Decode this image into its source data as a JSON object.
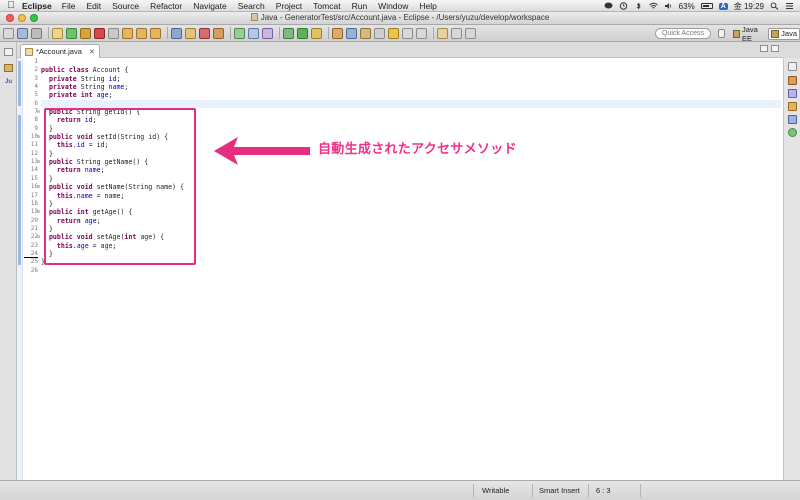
{
  "menubar": {
    "app_name": "Eclipse",
    "items": [
      "File",
      "Edit",
      "Source",
      "Refactor",
      "Navigate",
      "Search",
      "Project",
      "Tomcat",
      "Run",
      "Window",
      "Help"
    ],
    "battery": "63%",
    "input_badge": "A",
    "clock": "金 19:29"
  },
  "window": {
    "title": "Java - GeneratorTest/src/Account.java - Eclipse - /Users/yuzu/develop/workspace"
  },
  "toolbar": {
    "quick_access": "Quick Access",
    "perspectives": [
      {
        "label": "Java EE",
        "active": false
      },
      {
        "label": "Java",
        "active": true
      }
    ]
  },
  "editor_tab": {
    "label": "*Account.java",
    "close": "✕"
  },
  "code_lines": [
    {
      "n": "1",
      "t": ""
    },
    {
      "n": "2",
      "h": "<span class=\"kw\">public</span> <span class=\"kw\">class</span> Account {"
    },
    {
      "n": "3",
      "h": "  <span class=\"kw\">private</span> String <span class=\"fld\">id</span>;"
    },
    {
      "n": "4",
      "h": "  <span class=\"kw\">private</span> String <span class=\"fld\">name</span>;"
    },
    {
      "n": "5",
      "h": "  <span class=\"kw\">private</span> <span class=\"kw\">int</span> <span class=\"fld\">age</span>;"
    },
    {
      "n": "6",
      "t": "",
      "current": true
    },
    {
      "n": "7",
      "fold": true,
      "h": "  <span class=\"kw\">public</span> String getId() {"
    },
    {
      "n": "8",
      "h": "    <span class=\"kw\">return</span> <span class=\"fld\">id</span>;"
    },
    {
      "n": "9",
      "t": "  }"
    },
    {
      "n": "10",
      "fold": true,
      "h": "  <span class=\"kw\">public</span> <span class=\"kw\">void</span> setId(String id) {"
    },
    {
      "n": "11",
      "h": "    <span class=\"kw\">this</span>.<span class=\"fld\">id</span> = id;"
    },
    {
      "n": "12",
      "t": "  }"
    },
    {
      "n": "13",
      "fold": true,
      "h": "  <span class=\"kw\">public</span> String getName() {"
    },
    {
      "n": "14",
      "h": "    <span class=\"kw\">return</span> <span class=\"fld\">name</span>;"
    },
    {
      "n": "15",
      "t": "  }"
    },
    {
      "n": "16",
      "fold": true,
      "h": "  <span class=\"kw\">public</span> <span class=\"kw\">void</span> setName(String name) {"
    },
    {
      "n": "17",
      "h": "    <span class=\"kw\">this</span>.<span class=\"fld\">name</span> = name;"
    },
    {
      "n": "18",
      "t": "  }"
    },
    {
      "n": "19",
      "fold": true,
      "h": "  <span class=\"kw\">public</span> <span class=\"kw\">int</span> getAge() {"
    },
    {
      "n": "20",
      "h": "    <span class=\"kw\">return</span> <span class=\"fld\">age</span>;"
    },
    {
      "n": "21",
      "t": "  }"
    },
    {
      "n": "22",
      "fold": true,
      "h": "  <span class=\"kw\">public</span> <span class=\"kw\">void</span> setAge(<span class=\"kw\">int</span> age) {"
    },
    {
      "n": "23",
      "h": "    <span class=\"kw\">this</span>.<span class=\"fld\">age</span> = age;"
    },
    {
      "n": "24",
      "t": "  }",
      "cursor": true
    },
    {
      "n": "25",
      "t": "}"
    },
    {
      "n": "26",
      "t": ""
    }
  ],
  "annotation": {
    "text": "自動生成されたアクセサメソッド",
    "color": "#e62d7e"
  },
  "status": {
    "writable": "Writable",
    "insert_mode": "Smart Insert",
    "position": "6 : 3"
  },
  "colors": {
    "keyword": "#7f0055",
    "field": "#0000c0",
    "current_line": "#e8f2fe"
  }
}
